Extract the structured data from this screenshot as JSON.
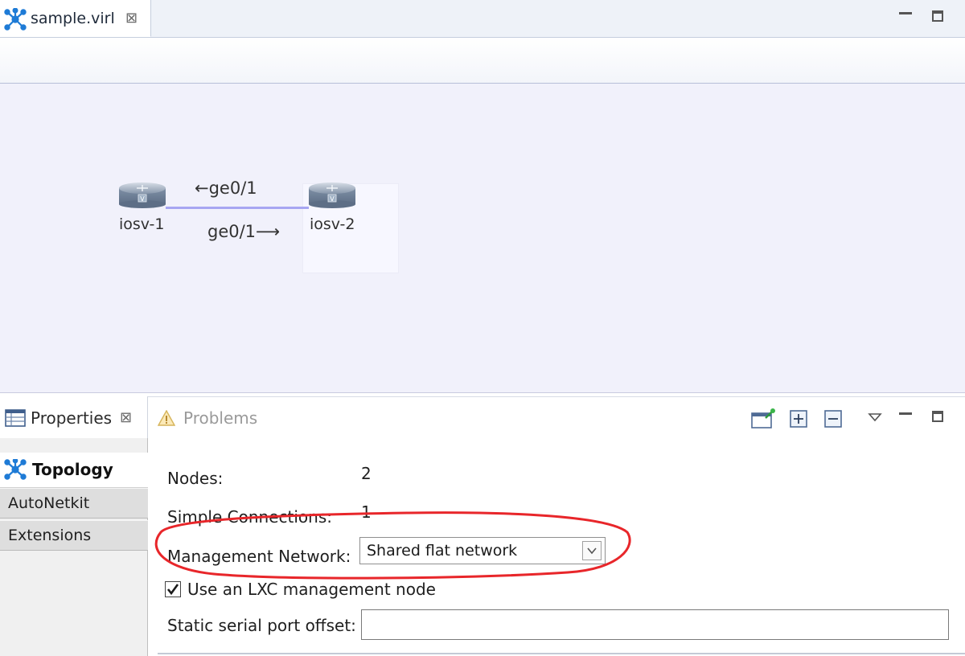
{
  "editor": {
    "tab_title": "sample.virl",
    "close_glyph": "⊠"
  },
  "topology": {
    "nodes": [
      {
        "label": "iosv-1",
        "icon": "router-icon"
      },
      {
        "label": "iosv-2",
        "icon": "router-icon"
      }
    ],
    "link": {
      "label_left": "←ge0/1",
      "label_right": "ge0/1⟶",
      "color": "#a7a6f2"
    }
  },
  "views": {
    "properties_label": "Properties",
    "problems_label": "Problems",
    "close_glyph": "⊠"
  },
  "nav": {
    "items": [
      "Topology",
      "AutoNetkit",
      "Extensions"
    ]
  },
  "form": {
    "nodes_label": "Nodes:",
    "nodes_value": "2",
    "connections_label": "Simple Connections:",
    "connections_value": "1",
    "mgmt_label": "Management Network:",
    "mgmt_value": "Shared flat network",
    "lxc_label": "Use an LXC management node",
    "lxc_checked": true,
    "serial_label": "Static serial port offset:",
    "serial_value": ""
  },
  "colors": {
    "canvas_bg": "#f1f1fb",
    "annotation": "#e8262a"
  }
}
